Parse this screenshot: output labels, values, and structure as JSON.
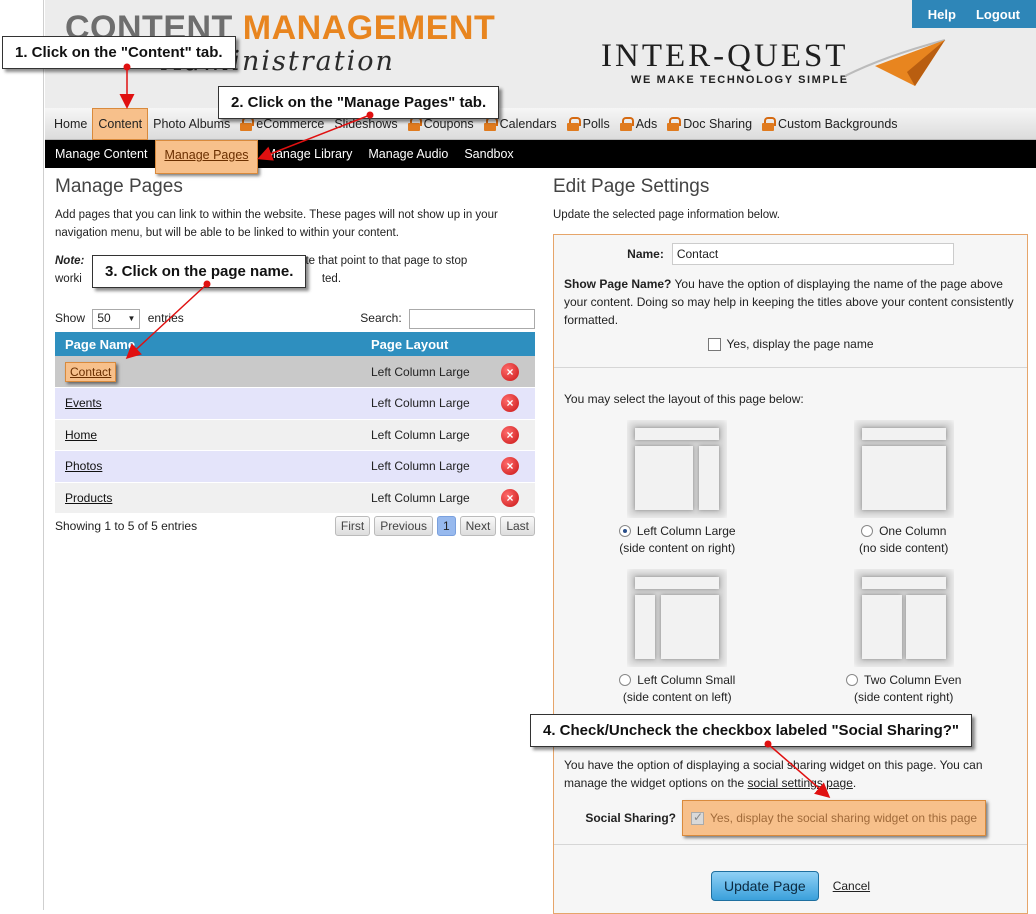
{
  "header": {
    "brand_part1": "CONTENT ",
    "brand_part2": "MANAGEMENT",
    "brand_sub": "Administration",
    "logo_text": "INTER-QUEST",
    "logo_tagline": "WE MAKE TECHNOLOGY SIMPLE",
    "help": "Help",
    "logout": "Logout"
  },
  "main_tabs": [
    {
      "label": "Home",
      "locked": false,
      "active": false
    },
    {
      "label": "Content",
      "locked": false,
      "active": true
    },
    {
      "label": "Photo Albums",
      "locked": false,
      "active": false
    },
    {
      "label": "eCommerce",
      "locked": true,
      "active": false
    },
    {
      "label": "Slideshows",
      "locked": false,
      "active": false
    },
    {
      "label": "Coupons",
      "locked": true,
      "active": false
    },
    {
      "label": "Calendars",
      "locked": true,
      "active": false
    },
    {
      "label": "Polls",
      "locked": true,
      "active": false
    },
    {
      "label": "Ads",
      "locked": true,
      "active": false
    },
    {
      "label": "Doc Sharing",
      "locked": true,
      "active": false
    },
    {
      "label": "Custom Backgrounds",
      "locked": true,
      "active": false
    }
  ],
  "sub_tabs": [
    {
      "label": "Manage Content",
      "active": false
    },
    {
      "label": "Manage Pages",
      "active": true
    },
    {
      "label": "Manage Library",
      "active": false
    },
    {
      "label": "Manage Audio",
      "active": false
    },
    {
      "label": "Sandbox",
      "active": false
    }
  ],
  "manage_pages": {
    "title": "Manage Pages",
    "description": "Add pages that you can link to within the website. These pages will not show up in your navigation menu, but will be able to be linked to within your content.",
    "note_label": "Note:",
    "note_text_start": "worki",
    "note_text_right1": "ebsite that point to that page to stop",
    "note_text_right2": "ted.",
    "show_label": "Show",
    "entries_value": "50",
    "entries_label": "entries",
    "search_label": "Search:",
    "columns": [
      "Page Name",
      "Page Layout"
    ],
    "rows": [
      {
        "name": "Contact",
        "layout": "Left Column Large"
      },
      {
        "name": "Events",
        "layout": "Left Column Large"
      },
      {
        "name": "Home",
        "layout": "Left Column Large"
      },
      {
        "name": "Photos",
        "layout": "Left Column Large"
      },
      {
        "name": "Products",
        "layout": "Left Column Large"
      }
    ],
    "info": "Showing 1 to 5 of 5 entries",
    "pager": {
      "first": "First",
      "previous": "Previous",
      "current": "1",
      "next": "Next",
      "last": "Last"
    }
  },
  "edit_settings": {
    "title": "Edit Page Settings",
    "subtitle": "Update the selected page information below.",
    "name_label": "Name:",
    "name_value": "Contact",
    "show_name_bold": "Show Page Name?",
    "show_name_text": " You have the option of displaying the name of the page above your content. Doing so may help in keeping the titles above your content consistently formatted.",
    "show_name_checkbox": "Yes, display the page name",
    "layout_intro": "You may select the layout of this page below:",
    "layouts": [
      {
        "label": "Left Column Large",
        "sub": "(side content on right)",
        "selected": true
      },
      {
        "label": "One Column",
        "sub": "(no side content)",
        "selected": false
      },
      {
        "label": "Left Column Small",
        "sub": "(side content on left)",
        "selected": false
      },
      {
        "label": "Two Column Even",
        "sub": "(side content right)",
        "selected": false
      }
    ],
    "social_text1": "You have the option of displaying a social sharing widget on this page. You can manage the widget options on the ",
    "social_link": "social settings page",
    "social_text2": ".",
    "social_label": "Social Sharing?",
    "social_checkbox": "Yes, display the social sharing widget on this page",
    "update_button": "Update Page",
    "cancel": "Cancel"
  },
  "callouts": {
    "step1": "1. Click on the \"Content\" tab.",
    "step2": "2. Click on the \"Manage Pages\" tab.",
    "step3": "3. Click on the page name.",
    "step4": "4. Check/Uncheck the checkbox labeled \"Social Sharing?\""
  }
}
